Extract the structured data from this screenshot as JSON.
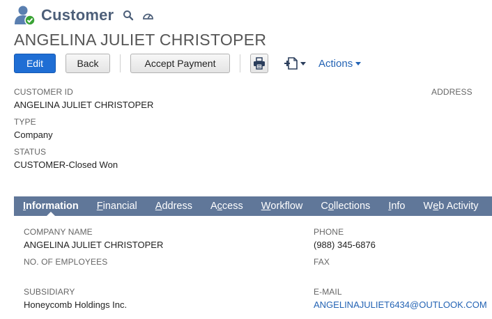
{
  "header": {
    "title": "Customer",
    "record_icon": "customer-checked-icon",
    "search_icon": "search-icon",
    "dashboard_icon": "dashboard-gauge-icon"
  },
  "record": {
    "name": "ANGELINA JULIET CHRISTOPER"
  },
  "toolbar": {
    "edit_label": "Edit",
    "back_label": "Back",
    "accept_payment_label": "Accept Payment",
    "print_icon": "print-icon",
    "new_doc_icon": "add-document-icon",
    "actions_label": "Actions"
  },
  "primary_fields": {
    "customer_id_label": "CUSTOMER ID",
    "customer_id_value": "ANGELINA JULIET CHRISTOPER",
    "type_label": "TYPE",
    "type_value": "Company",
    "status_label": "STATUS",
    "status_value": "CUSTOMER-Closed Won",
    "address_label": "ADDRESS"
  },
  "tabs": [
    {
      "pre": "",
      "accel": "I",
      "post": "nformation",
      "active": true
    },
    {
      "pre": "",
      "accel": "F",
      "post": "inancial",
      "active": false
    },
    {
      "pre": "",
      "accel": "A",
      "post": "ddress",
      "active": false
    },
    {
      "pre": "A",
      "accel": "c",
      "post": "cess",
      "active": false
    },
    {
      "pre": "",
      "accel": "W",
      "post": "orkflow",
      "active": false
    },
    {
      "pre": "C",
      "accel": "o",
      "post": "llections",
      "active": false
    },
    {
      "pre": "",
      "accel": "I",
      "post": "nfo",
      "active": false
    },
    {
      "pre": "W",
      "accel": "e",
      "post": "b Activity",
      "active": false
    }
  ],
  "info": {
    "company_name_label": "COMPANY NAME",
    "company_name_value": "ANGELINA JULIET CHRISTOPER",
    "employees_label": "NO. OF EMPLOYEES",
    "subsidiary_label": "SUBSIDIARY",
    "subsidiary_value": "Honeycomb Holdings Inc.",
    "phone_label": "PHONE",
    "phone_value": "(988) 345-6876",
    "fax_label": "FAX",
    "email_label": "E-MAIL",
    "email_value": "ANGELINAJULIET6434@OUTLOOK.COM"
  },
  "colors": {
    "accent_blue": "#1f6ed4",
    "tab_bar": "#607799",
    "link": "#2363b4",
    "title": "#4d5f79"
  }
}
